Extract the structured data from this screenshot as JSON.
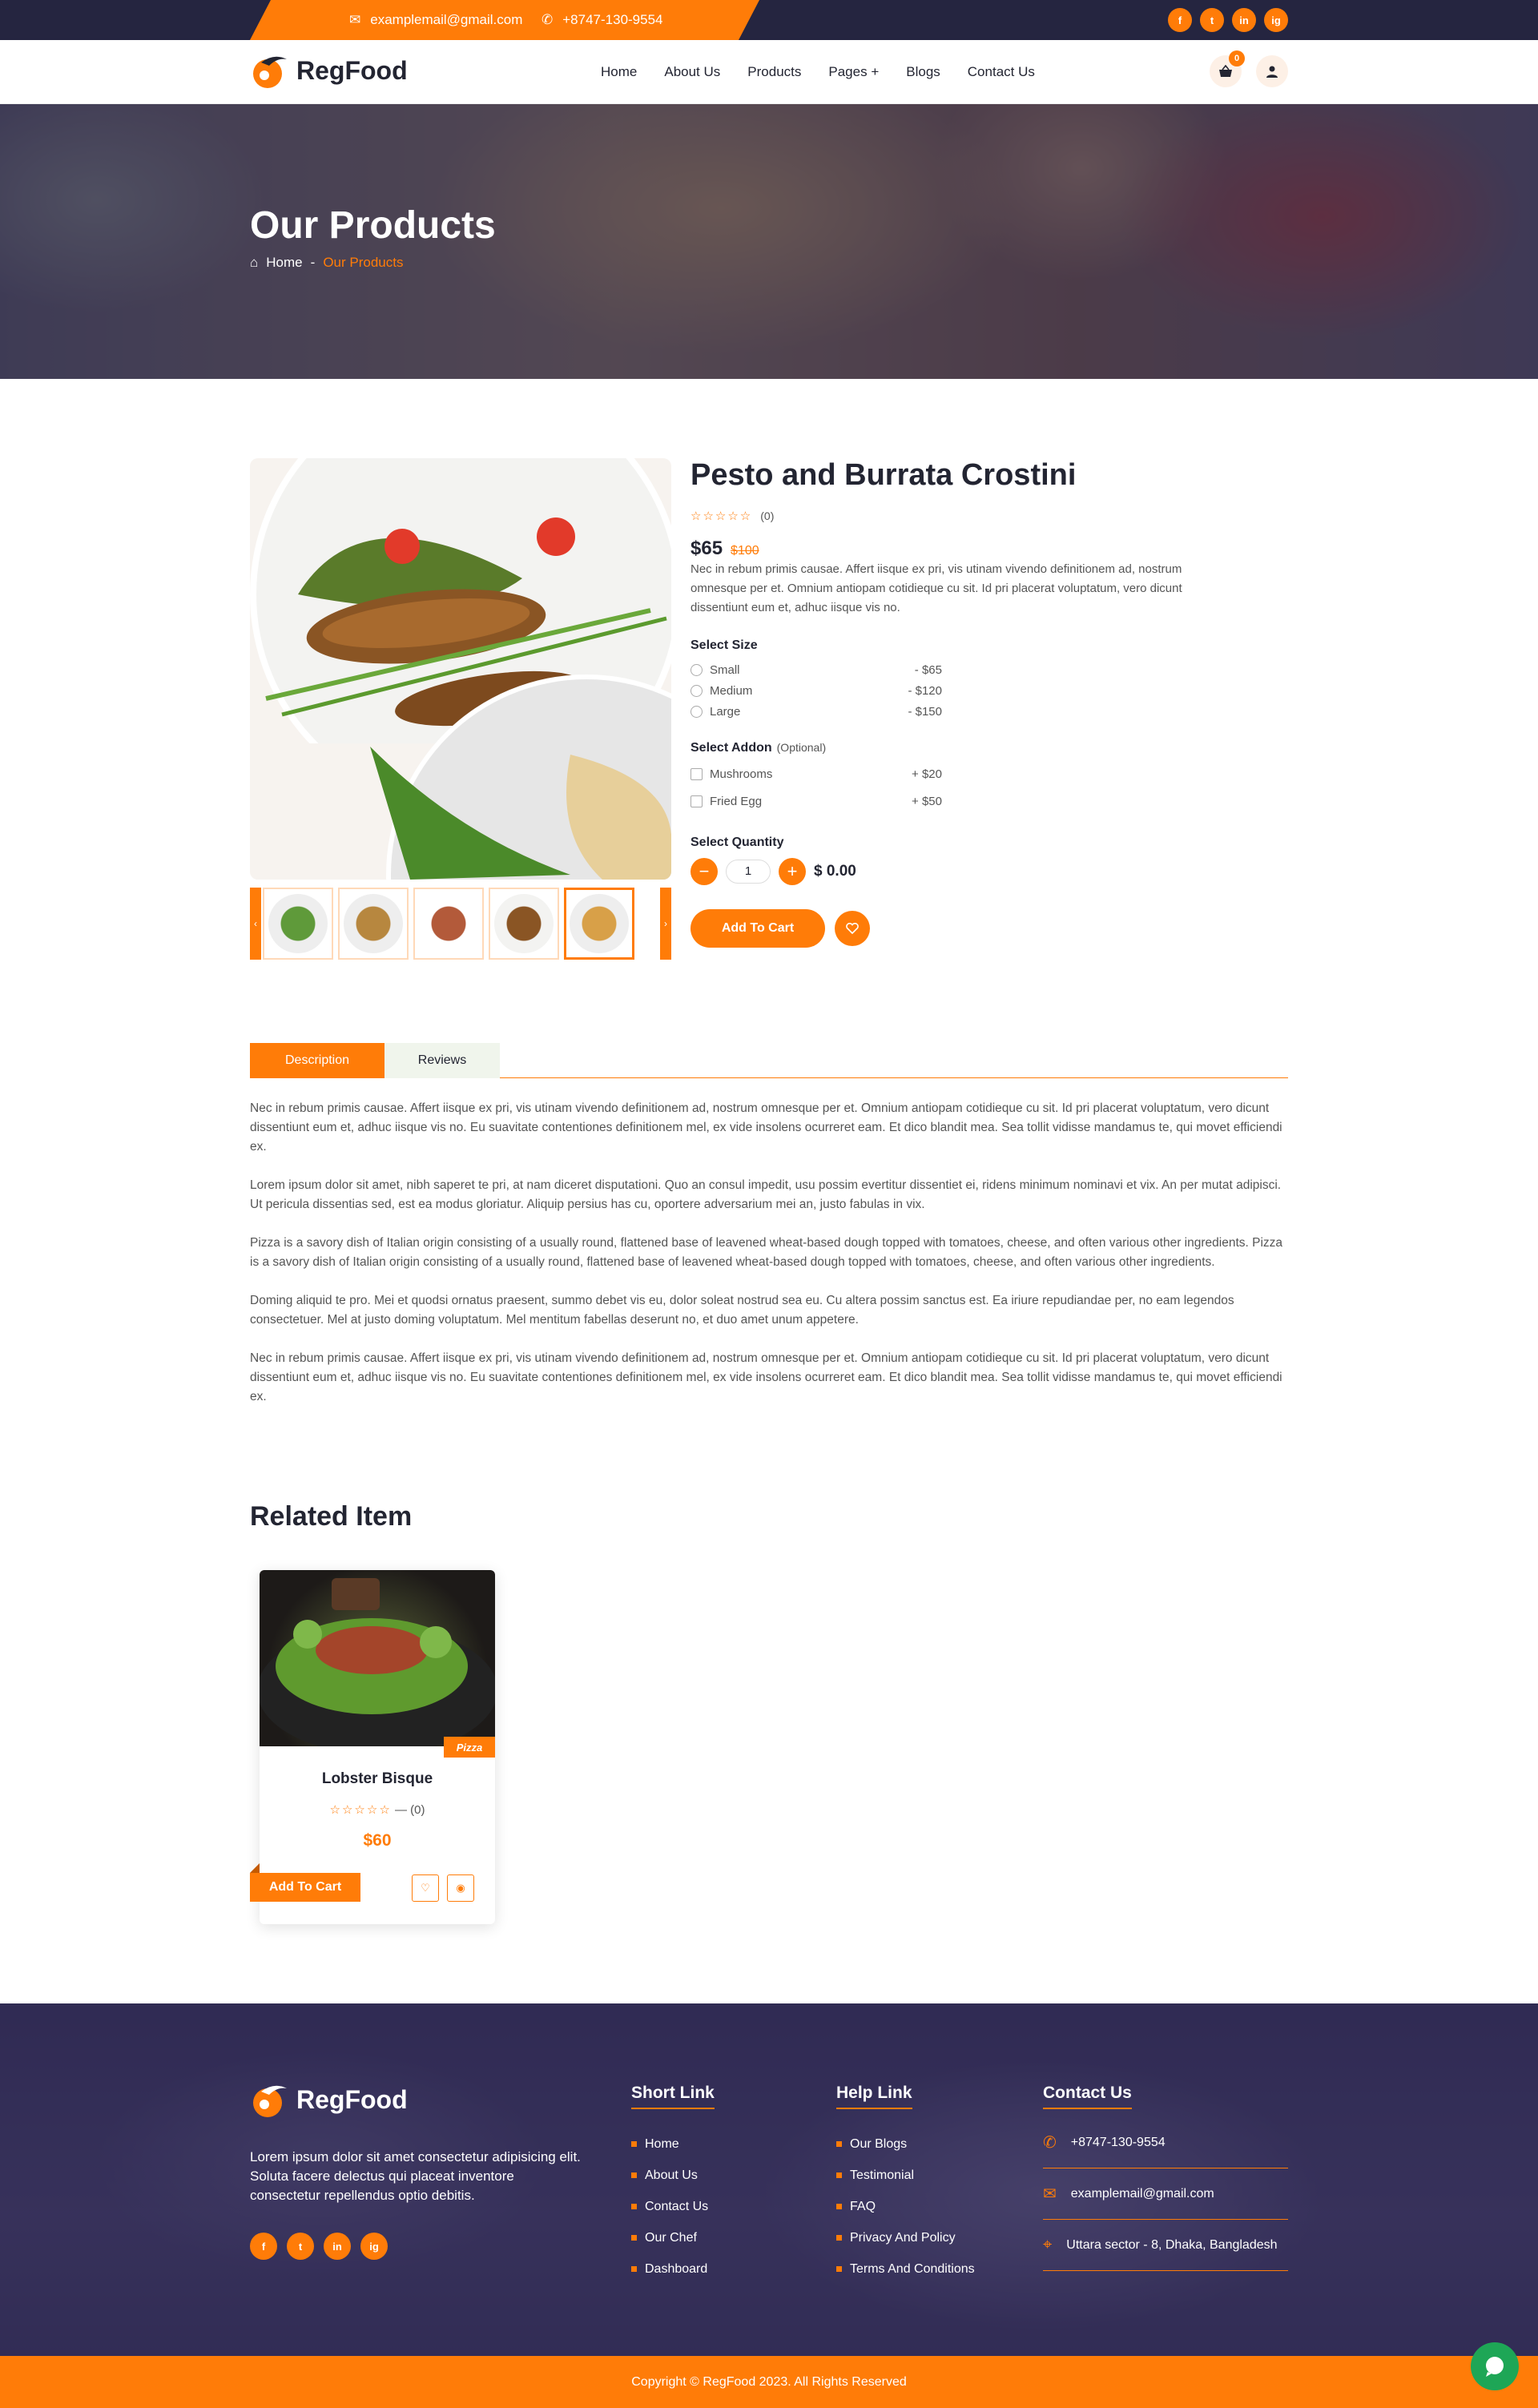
{
  "topbar": {
    "email": "examplemail@gmail.com",
    "phone": "+8747-130-9554",
    "social": [
      "f",
      "t",
      "in",
      "ig"
    ]
  },
  "brand": {
    "name": "RegFood",
    "accent": "#ff7c08",
    "dark": "#232532"
  },
  "nav": {
    "items": [
      "Home",
      "About Us",
      "Products",
      "Pages +",
      "Blogs",
      "Contact Us"
    ],
    "cart_count": "0"
  },
  "banner": {
    "title": "Our Products",
    "crumb_home": "Home",
    "crumb_sep": "-",
    "crumb_current": "Our Products"
  },
  "product": {
    "title": "Pesto and Burrata Crostini",
    "reviews": "(0)",
    "price": "$65",
    "old_price": "$100",
    "description": "Nec in rebum primis causae. Affert iisque ex pri, vis utinam vivendo definitionem ad, nostrum omnesque per et. Omnium antiopam cotidieque cu sit. Id pri placerat voluptatum, vero dicunt dissentiunt eum et, adhuc iisque vis no.",
    "size_label": "Select Size",
    "sizes": [
      {
        "name": "Small",
        "price": "- $65"
      },
      {
        "name": "Medium",
        "price": "- $120"
      },
      {
        "name": "Large",
        "price": "- $150"
      }
    ],
    "addon_label": "Select Addon",
    "addon_note": "(Optional)",
    "addons": [
      {
        "name": "Mushrooms",
        "price": "+ $20"
      },
      {
        "name": "Fried Egg",
        "price": "+ $50"
      }
    ],
    "qty_label": "Select Quantity",
    "qty": "1",
    "minus": "−",
    "plus": "+",
    "total": "$ 0.00",
    "cart_button": "Add To Cart"
  },
  "tabs": {
    "description": "Description",
    "reviews": "Reviews"
  },
  "description_paragraphs": [
    "Nec in rebum primis causae. Affert iisque ex pri, vis utinam vivendo definitionem ad, nostrum omnesque per et. Omnium antiopam cotidieque cu sit. Id pri placerat voluptatum, vero dicunt dissentiunt eum et, adhuc iisque vis no. Eu suavitate contentiones definitionem mel, ex vide insolens ocurreret eam. Et dico blandit mea. Sea tollit vidisse mandamus te, qui movet efficiendi ex.",
    "Lorem ipsum dolor sit amet, nibh saperet te pri, at nam diceret disputationi. Quo an consul impedit, usu possim evertitur dissentiet ei, ridens minimum nominavi et vix. An per mutat adipisci. Ut pericula dissentias sed, est ea modus gloriatur. Aliquip persius has cu, oportere adversarium mei an, justo fabulas in vix.",
    "Pizza is a savory dish of Italian origin consisting of a usually round, flattened base of leavened wheat-based dough topped with tomatoes, cheese, and often various other ingredients. Pizza is a savory dish of Italian origin consisting of a usually round, flattened base of leavened wheat-based dough topped with tomatoes, cheese, and often various other ingredients.",
    "Doming aliquid te pro. Mei et quodsi ornatus praesent, summo debet vis eu, dolor soleat nostrud sea eu. Cu altera possim sanctus est. Ea iriure repudiandae per, no eam legendos consectetuer. Mel at justo doming voluptatum. Mel mentitum fabellas deserunt no, et duo amet unum appetere.",
    "Nec in rebum primis causae. Affert iisque ex pri, vis utinam vivendo definitionem ad, nostrum omnesque per et. Omnium antiopam cotidieque cu sit. Id pri placerat voluptatum, vero dicunt dissentiunt eum et, adhuc iisque vis no. Eu suavitate contentiones definitionem mel, ex vide insolens ocurreret eam. Et dico blandit mea. Sea tollit vidisse mandamus te, qui movet efficiendi ex."
  ],
  "related": {
    "title": "Related Item",
    "card": {
      "tag": "Pizza",
      "name": "Lobster Bisque",
      "reviews": "— (0)",
      "price": "$60",
      "button": "Add To Cart"
    }
  },
  "footer": {
    "about": "Lorem ipsum dolor sit amet consectetur adipisicing elit. Soluta facere delectus qui placeat inventore consectetur repellendus optio debitis.",
    "short_title": "Short Link",
    "short_links": [
      "Home",
      "About Us",
      "Contact Us",
      "Our Chef",
      "Dashboard"
    ],
    "help_title": "Help Link",
    "help_links": [
      "Our Blogs",
      "Testimonial",
      "FAQ",
      "Privacy And Policy",
      "Terms And Conditions"
    ],
    "contact_title": "Contact Us",
    "phone": "+8747-130-9554",
    "email": "examplemail@gmail.com",
    "address": "Uttara sector - 8, Dhaka, Bangladesh",
    "copyright": "Copyright © RegFood 2023. All Rights Reserved"
  }
}
